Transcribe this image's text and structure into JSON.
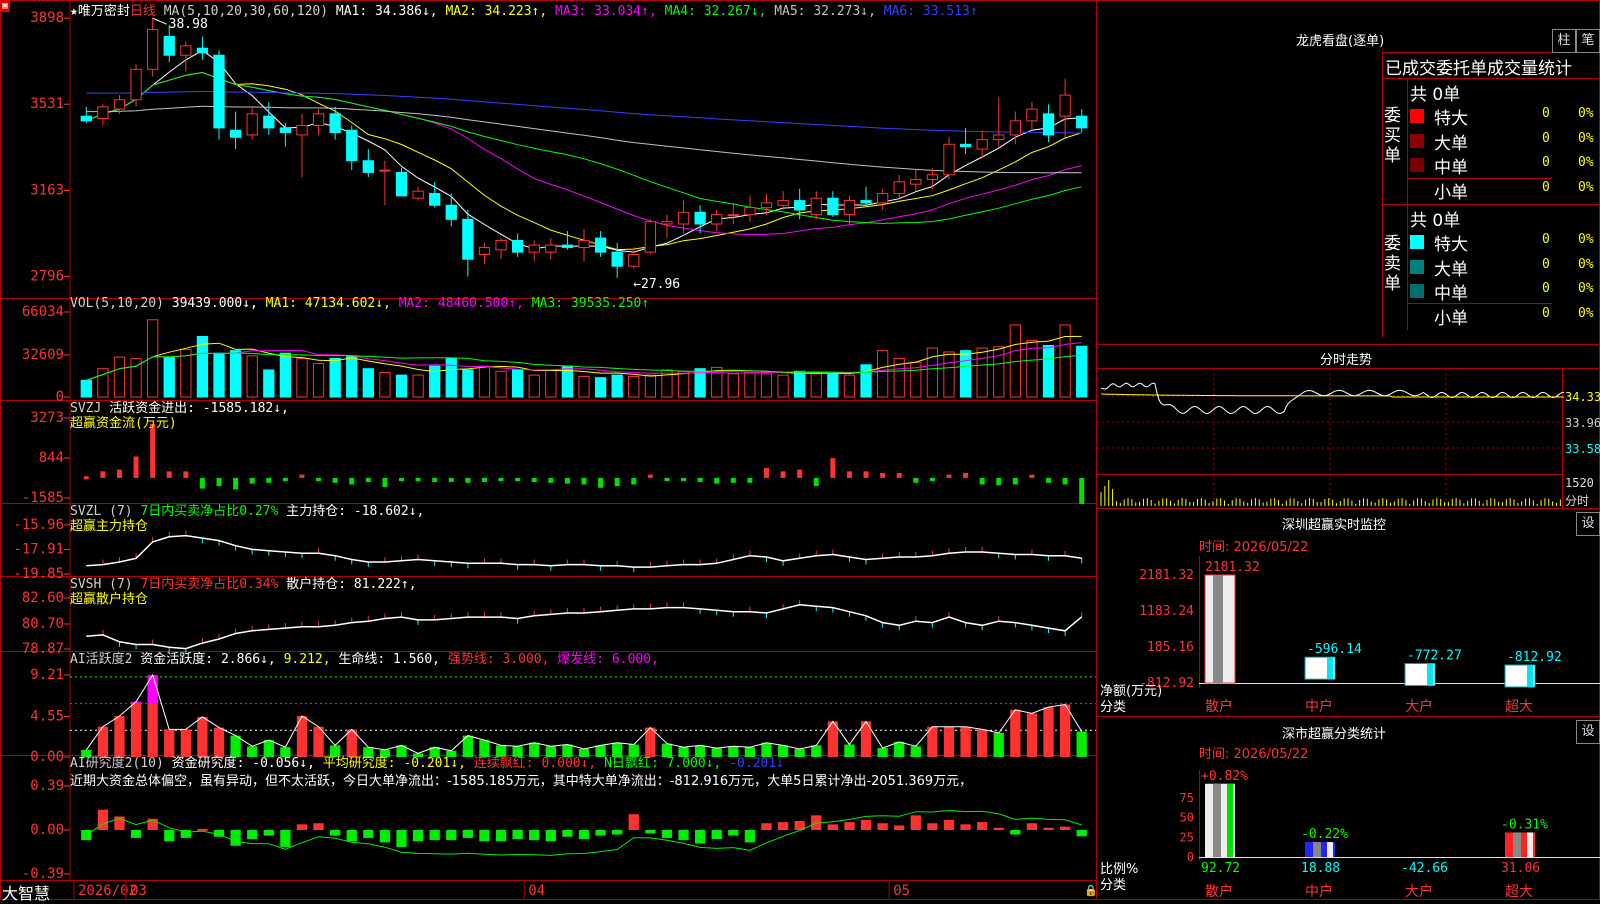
{
  "app": {
    "brand": "大智慧",
    "corner_icon": "lock-icon"
  },
  "colors": {
    "up": "#ff3232",
    "down": "#00ffff",
    "green": "#00e000",
    "bg": "#000000",
    "frame": "#b00000"
  },
  "main_panel": {
    "star": "★",
    "name": "唯万密封",
    "period": "日线",
    "legend": [
      {
        "text": "MA(5,10,20,30,60,120)",
        "color": "#d0d0d0"
      },
      {
        "text": "MA1: 34.386↓,",
        "color": "#ffffff"
      },
      {
        "text": "MA2: 34.223↑,",
        "color": "#ffff00"
      },
      {
        "text": "MA3: 33.034↑,",
        "color": "#ff00ff"
      },
      {
        "text": "MA4: 32.267↓,",
        "color": "#00ff00"
      },
      {
        "text": "MA5: 32.273↓,",
        "color": "#c0c0c0"
      },
      {
        "text": "MA6: 33.513↑",
        "color": "#3040ff"
      }
    ],
    "y_ticks": [
      "3898",
      "3531",
      "3163",
      "2796"
    ],
    "high_label": "38.98",
    "low_label": "27.96"
  },
  "vol_panel": {
    "legend": [
      {
        "text": "VOL(5,10,20)",
        "color": "#d0d0d0"
      },
      {
        "text": "39439.000↓,",
        "color": "#ffffff"
      },
      {
        "text": "MA1: 47134.602↓,",
        "color": "#ffff00"
      },
      {
        "text": "MA2: 48460.500↑,",
        "color": "#ff00ff"
      },
      {
        "text": "MA3: 39535.250↑",
        "color": "#00ff00"
      }
    ],
    "y_ticks": [
      "66034",
      "32609",
      "0"
    ]
  },
  "svzj_panel": {
    "legend": [
      {
        "text": "SVZJ",
        "color": "#d0d0d0"
      },
      {
        "text": "活跃资金进出: -1585.182↓,",
        "color": "#ffffff"
      }
    ],
    "sub": "超赢资金流(万元)",
    "y_ticks": [
      "3273",
      "844",
      "-1585"
    ]
  },
  "svzl_panel": {
    "legend": [
      {
        "text": "SVZL (7)",
        "color": "#d0d0d0"
      },
      {
        "text": "7日内买卖净占比0.27%",
        "color": "#00ff00"
      },
      {
        "text": "主力持仓: -18.602↓,",
        "color": "#ffffff"
      }
    ],
    "sub": "超赢主力持仓",
    "y_ticks": [
      "-15.96",
      "-17.91",
      "-19.85"
    ]
  },
  "svsh_panel": {
    "legend": [
      {
        "text": "SVSH (7)",
        "color": "#d0d0d0"
      },
      {
        "text": "7日内买卖净占比0.34%",
        "color": "#ff3232"
      },
      {
        "text": "散户持仓: 81.222↑,",
        "color": "#ffffff"
      }
    ],
    "sub": "超赢散户持仓",
    "y_ticks": [
      "82.60",
      "80.70",
      "78.87"
    ]
  },
  "ai_active_panel": {
    "legend": [
      {
        "text": "AI活跃度2",
        "color": "#d0d0d0"
      },
      {
        "text": "资金活跃度: 2.866↓,",
        "color": "#ffffff"
      },
      {
        "text": "9.212,",
        "color": "#ffff00"
      },
      {
        "text": "生命线: 1.560,",
        "color": "#ffffff"
      },
      {
        "text": "强势线: 3.000,",
        "color": "#ff3232"
      },
      {
        "text": "爆发线: 6.000,",
        "color": "#ff00ff"
      }
    ],
    "y_ticks": [
      "9.21",
      "4.55",
      "0.00"
    ]
  },
  "ai_research_panel": {
    "legend": [
      {
        "text": "AI研究度2(10)",
        "color": "#d0d0d0"
      },
      {
        "text": "资金研究度: -0.056↓,",
        "color": "#ffffff"
      },
      {
        "text": "平均研究度: -0.201↓,",
        "color": "#ffff00"
      },
      {
        "text": "连续飘红: 0.000↓,",
        "color": "#ff3232"
      },
      {
        "text": "N日飘红: 7.000↓,",
        "color": "#00ff00"
      },
      {
        "text": "-0.201↓",
        "color": "#3040ff"
      }
    ],
    "comment": "近期大资金总体偏空，虽有异动，但不太活跃，今日大单净流出：-1585.185万元，其中特大单净流出：-812.916万元，大单5日累计净出-2051.369万元，",
    "y_ticks": [
      "0.39",
      "0.00",
      "-0.39"
    ]
  },
  "x_axis": {
    "labels": [
      "2026/02",
      "03",
      "04",
      "05"
    ]
  },
  "right": {
    "dragon": {
      "title": "龙虎看盘(逐单)",
      "btn1": "柱",
      "btn2": "笔",
      "header": "已成交委托单成交量统计",
      "buy_label": "委买单",
      "sell_label": "委卖单",
      "buy_total": "共 0单",
      "sell_total": "共 0单",
      "buy_rows": [
        {
          "label": "特大",
          "val": "0",
          "pct": "0%",
          "color": "#ff0000"
        },
        {
          "label": "大单",
          "val": "0",
          "pct": "0%",
          "color": "#8b0000"
        },
        {
          "label": "中单",
          "val": "0",
          "pct": "0%",
          "color": "#7a0000"
        },
        {
          "label": "小单",
          "val": "0",
          "pct": "0%",
          "color": ""
        }
      ],
      "sell_rows": [
        {
          "label": "特大",
          "val": "0",
          "pct": "0%",
          "color": "#00ffff"
        },
        {
          "label": "大单",
          "val": "0",
          "pct": "0%",
          "color": "#008080"
        },
        {
          "label": "中单",
          "val": "0",
          "pct": "0%",
          "color": "#006f6f"
        },
        {
          "label": "小单",
          "val": "0",
          "pct": "0%",
          "color": ""
        }
      ]
    },
    "intraday": {
      "title": "分时走势",
      "y_labels": [
        "34.33",
        "33.96",
        "33.58"
      ],
      "vol_label": "1520",
      "vol_sub": "分时"
    },
    "monitor": {
      "title": "深圳超赢实时监控",
      "settings": "设",
      "time": "时间: 2026/05/22",
      "y_ticks": [
        "2181.32",
        "1183.24",
        "185.16",
        "-812.92"
      ],
      "unit": "净额(万元)",
      "unit2": "分类",
      "chart_data": {
        "type": "bar",
        "categories": [
          "散户",
          "中户",
          "大户",
          "超大"
        ],
        "values": [
          2181.32,
          -596.14,
          -772.27,
          -812.92
        ],
        "ylim": [
          -812.92,
          2181.32
        ]
      }
    },
    "classify": {
      "title": "深市超赢分类统计",
      "settings": "设",
      "time": "时间: 2026/05/22",
      "y_ticks": [
        "75",
        "50",
        "25",
        "0"
      ],
      "unit": "比例%",
      "unit2": "分类",
      "chart_data": {
        "type": "bar",
        "categories": [
          "散户",
          "中户",
          "大户",
          "超大"
        ],
        "top_labels": [
          "+0.82%",
          "-0.22%",
          "",
          "-0.31%"
        ],
        "values": [
          92.72,
          18.88,
          -42.66,
          31.06
        ],
        "value_labels": [
          "92.72",
          "18.88",
          "-42.66",
          "31.06"
        ],
        "ylim": [
          0,
          100
        ]
      }
    }
  },
  "chart_data": {
    "type": "candlestick",
    "n_days": 61,
    "ohlc": [
      [
        34.8,
        35.2,
        34.5,
        34.6
      ],
      [
        34.7,
        35.3,
        34.4,
        35.2
      ],
      [
        35.1,
        35.7,
        34.9,
        35.5
      ],
      [
        35.5,
        37.0,
        35.2,
        36.8
      ],
      [
        36.8,
        38.98,
        36.5,
        38.5
      ],
      [
        38.2,
        38.7,
        37.1,
        37.4
      ],
      [
        37.4,
        38.0,
        36.7,
        37.8
      ],
      [
        37.7,
        38.2,
        37.2,
        37.5
      ],
      [
        37.4,
        37.6,
        33.8,
        34.3
      ],
      [
        34.2,
        35.0,
        33.4,
        33.9
      ],
      [
        34.0,
        35.2,
        33.8,
        34.9
      ],
      [
        34.8,
        35.4,
        34.0,
        34.3
      ],
      [
        34.3,
        34.5,
        33.5,
        34.1
      ],
      [
        34.0,
        34.9,
        32.2,
        34.4
      ],
      [
        34.4,
        35.1,
        34.0,
        34.9
      ],
      [
        34.9,
        35.2,
        33.8,
        34.1
      ],
      [
        34.2,
        34.4,
        32.5,
        32.9
      ],
      [
        32.9,
        33.4,
        32.2,
        32.4
      ],
      [
        32.5,
        32.9,
        31.0,
        32.5
      ],
      [
        32.4,
        32.6,
        31.4,
        31.4
      ],
      [
        31.3,
        31.8,
        31.2,
        31.6
      ],
      [
        31.5,
        32.0,
        30.9,
        31.0
      ],
      [
        31.0,
        31.5,
        30.1,
        30.4
      ],
      [
        30.4,
        30.8,
        27.96,
        28.7
      ],
      [
        28.9,
        29.4,
        28.5,
        29.2
      ],
      [
        29.1,
        29.6,
        28.7,
        29.5
      ],
      [
        29.5,
        29.8,
        28.8,
        29.0
      ],
      [
        29.0,
        29.5,
        28.6,
        29.3
      ],
      [
        29.0,
        29.6,
        28.7,
        29.3
      ],
      [
        29.3,
        29.9,
        29.1,
        29.2
      ],
      [
        29.2,
        30.0,
        28.6,
        29.5
      ],
      [
        29.6,
        29.9,
        28.8,
        29.0
      ],
      [
        29.0,
        29.4,
        27.9,
        28.4
      ],
      [
        28.4,
        29.2,
        28.3,
        28.9
      ],
      [
        29.0,
        30.4,
        28.9,
        30.3
      ],
      [
        30.2,
        30.6,
        29.6,
        30.3
      ],
      [
        30.2,
        31.2,
        29.8,
        30.7
      ],
      [
        30.7,
        31.0,
        29.8,
        30.2
      ],
      [
        30.2,
        30.8,
        29.9,
        30.6
      ],
      [
        30.6,
        31.1,
        30.2,
        30.6
      ],
      [
        30.6,
        31.4,
        30.3,
        30.9
      ],
      [
        30.9,
        31.5,
        30.6,
        31.1
      ],
      [
        31.0,
        31.6,
        30.8,
        31.2
      ],
      [
        31.2,
        31.7,
        30.4,
        30.8
      ],
      [
        30.6,
        31.6,
        30.4,
        31.3
      ],
      [
        31.3,
        31.6,
        30.5,
        30.6
      ],
      [
        30.6,
        31.4,
        30.2,
        31.2
      ],
      [
        31.2,
        31.8,
        31.0,
        31.1
      ],
      [
        31.1,
        31.7,
        30.8,
        31.5
      ],
      [
        31.5,
        32.3,
        31.3,
        32.0
      ],
      [
        31.9,
        32.5,
        31.6,
        32.1
      ],
      [
        32.1,
        32.6,
        31.7,
        32.3
      ],
      [
        32.3,
        33.9,
        32.1,
        33.6
      ],
      [
        33.6,
        34.3,
        33.2,
        33.5
      ],
      [
        33.4,
        34.2,
        33.0,
        33.8
      ],
      [
        33.8,
        35.6,
        33.5,
        34.0
      ],
      [
        34.0,
        35.0,
        33.6,
        34.6
      ],
      [
        34.6,
        35.4,
        34.2,
        35.1
      ],
      [
        34.9,
        35.3,
        33.7,
        34.0
      ],
      [
        34.8,
        36.4,
        33.9,
        35.7
      ],
      [
        34.8,
        35.1,
        34.1,
        34.3
      ]
    ],
    "volume": [
      13000,
      22000,
      31000,
      30000,
      60000,
      31000,
      37000,
      47000,
      34000,
      36000,
      32000,
      21000,
      34000,
      30000,
      26000,
      30000,
      32000,
      22000,
      19000,
      17000,
      17000,
      24000,
      30000,
      21000,
      24000,
      20000,
      21000,
      17000,
      21000,
      24000,
      16000,
      15000,
      17000,
      16000,
      17000,
      21000,
      20000,
      22000,
      23000,
      18000,
      19000,
      18000,
      17000,
      20000,
      18000,
      19000,
      17000,
      25000,
      36000,
      30000,
      27000,
      38000,
      35000,
      36000,
      38000,
      39000,
      56000,
      44000,
      40000,
      56000,
      39439
    ],
    "svzj": [
      100,
      400,
      500,
      1300,
      3273,
      400,
      400,
      -650,
      -500,
      -700,
      -350,
      -300,
      -200,
      200,
      -200,
      -300,
      -400,
      -250,
      -550,
      -200,
      -200,
      -250,
      -250,
      -300,
      -250,
      -200,
      -200,
      -250,
      -300,
      -350,
      -400,
      -600,
      -500,
      -400,
      200,
      -200,
      -200,
      -250,
      -350,
      -300,
      -300,
      600,
      400,
      500,
      -500,
      1200,
      400,
      400,
      300,
      300,
      -300,
      -200,
      200,
      300,
      -400,
      -450,
      -400,
      200,
      -300,
      -400,
      -1585.182
    ],
    "svzl": [
      -19.2,
      -19.1,
      -18.9,
      -18.6,
      -17.3,
      -16.9,
      -16.8,
      -17.0,
      -17.2,
      -17.6,
      -17.9,
      -18.0,
      -18.1,
      -18.2,
      -18.2,
      -18.4,
      -18.7,
      -18.9,
      -18.9,
      -18.8,
      -18.7,
      -18.8,
      -18.9,
      -19.0,
      -19.0,
      -19.0,
      -19.1,
      -19.1,
      -19.2,
      -19.1,
      -19.1,
      -19.2,
      -19.2,
      -19.3,
      -19.3,
      -19.2,
      -19.1,
      -19.1,
      -19.0,
      -18.7,
      -18.4,
      -18.5,
      -18.8,
      -18.6,
      -18.4,
      -18.3,
      -18.5,
      -18.7,
      -18.6,
      -18.5,
      -18.5,
      -18.4,
      -18.2,
      -18.1,
      -18.1,
      -18.2,
      -18.3,
      -18.3,
      -18.4,
      -18.4,
      -18.602
    ],
    "svsh": [
      79.8,
      79.9,
      79.4,
      79.2,
      79.2,
      79.0,
      78.9,
      79.3,
      79.6,
      80.0,
      80.2,
      80.3,
      80.4,
      80.5,
      80.5,
      80.6,
      80.8,
      80.9,
      81.1,
      81.2,
      81.0,
      81.0,
      81.1,
      81.2,
      81.2,
      81.2,
      81.1,
      81.3,
      81.4,
      81.5,
      81.5,
      81.6,
      81.7,
      81.8,
      81.8,
      81.9,
      81.9,
      81.8,
      81.7,
      81.6,
      81.6,
      81.5,
      81.8,
      82.1,
      82.0,
      81.9,
      81.6,
      81.3,
      80.8,
      80.6,
      80.9,
      80.8,
      81.2,
      80.8,
      80.6,
      80.9,
      80.8,
      80.6,
      80.4,
      80.2,
      81.222
    ],
    "ai_active": [
      0.8,
      3.4,
      4.6,
      6.2,
      9.21,
      3.1,
      3.1,
      4.5,
      3.3,
      2.4,
      1.2,
      1.9,
      1.1,
      4.6,
      3.4,
      1.3,
      3.1,
      1.1,
      0.8,
      1.3,
      0.4,
      1.1,
      0.7,
      2.4,
      1.9,
      1.3,
      1.2,
      1.6,
      1.2,
      1.4,
      0.9,
      1.3,
      1.6,
      1.4,
      3.3,
      1.5,
      1.1,
      1.3,
      1.0,
      1.2,
      1.1,
      1.6,
      1.3,
      0.9,
      1.3,
      4.0,
      1.4,
      4.0,
      1.0,
      1.7,
      1.2,
      3.4,
      3.4,
      3.4,
      3.1,
      2.7,
      5.3,
      4.9,
      5.6,
      5.9,
      2.866
    ],
    "ai_research": [
      -0.09,
      0.18,
      0.12,
      -0.07,
      0.1,
      -0.1,
      -0.07,
      0.01,
      -0.06,
      -0.14,
      -0.08,
      -0.05,
      -0.15,
      0.05,
      0.06,
      -0.05,
      -0.1,
      -0.07,
      -0.11,
      -0.15,
      -0.1,
      -0.09,
      -0.09,
      -0.07,
      -0.1,
      -0.1,
      -0.08,
      -0.09,
      -0.1,
      -0.06,
      -0.08,
      -0.05,
      -0.04,
      0.14,
      -0.03,
      -0.07,
      -0.09,
      -0.12,
      -0.08,
      -0.05,
      -0.11,
      0.06,
      0.07,
      0.08,
      0.13,
      0.05,
      0.07,
      0.09,
      0.06,
      0.04,
      0.13,
      0.06,
      0.09,
      0.05,
      0.07,
      0.02,
      -0.04,
      0.06,
      0.02,
      0.03,
      -0.056
    ]
  }
}
